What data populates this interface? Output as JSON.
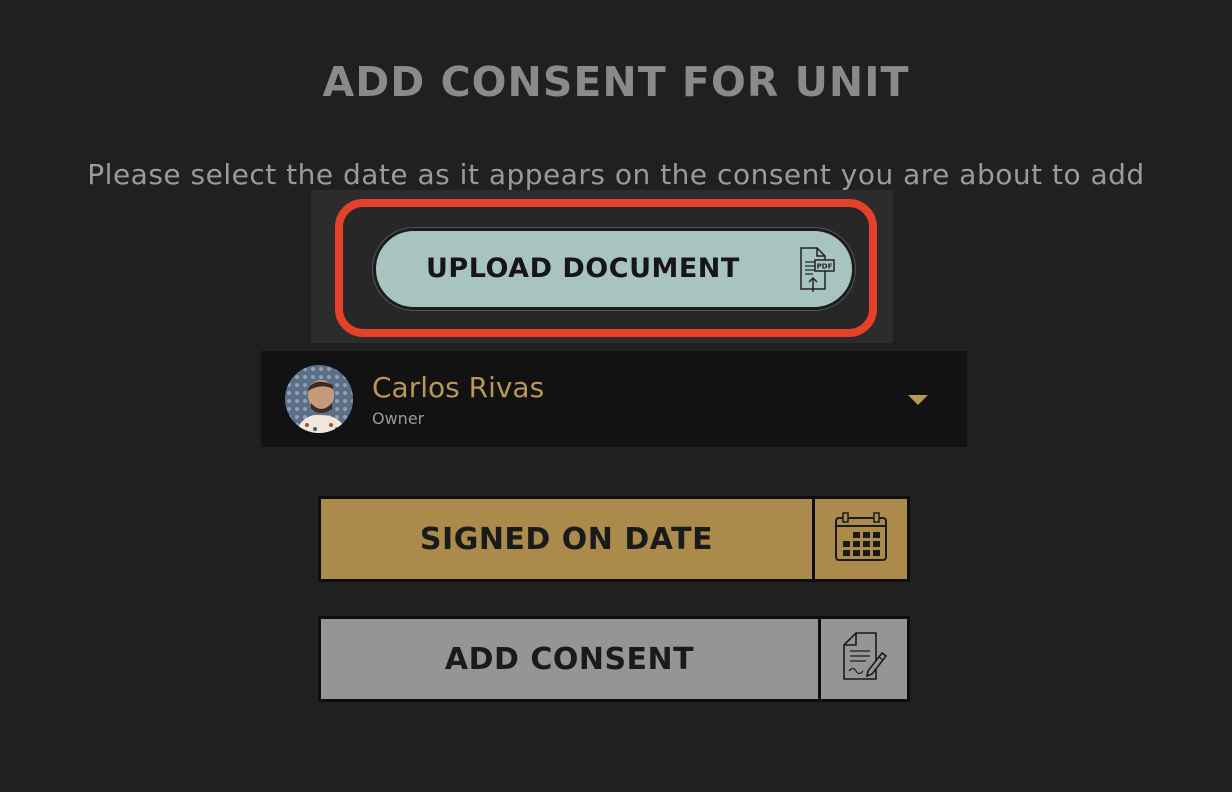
{
  "page": {
    "title": "ADD CONSENT FOR UNIT",
    "subtitle": "Please select the date as it appears on the consent you are about to add"
  },
  "upload": {
    "label": "UPLOAD DOCUMENT",
    "icon": "pdf-upload-icon",
    "icon_text": "PDF",
    "highlight_color": "#e5402a",
    "button_color": "#a8c4c1"
  },
  "owner": {
    "name": "Carlos Rivas",
    "role": "Owner",
    "name_color": "#b89757"
  },
  "actions": {
    "signed_label": "SIGNED ON DATE",
    "signed_icon": "calendar-icon",
    "signed_color": "#aa8b4b",
    "consent_label": "ADD CONSENT",
    "consent_icon": "signed-document-icon",
    "consent_color": "#959595"
  }
}
